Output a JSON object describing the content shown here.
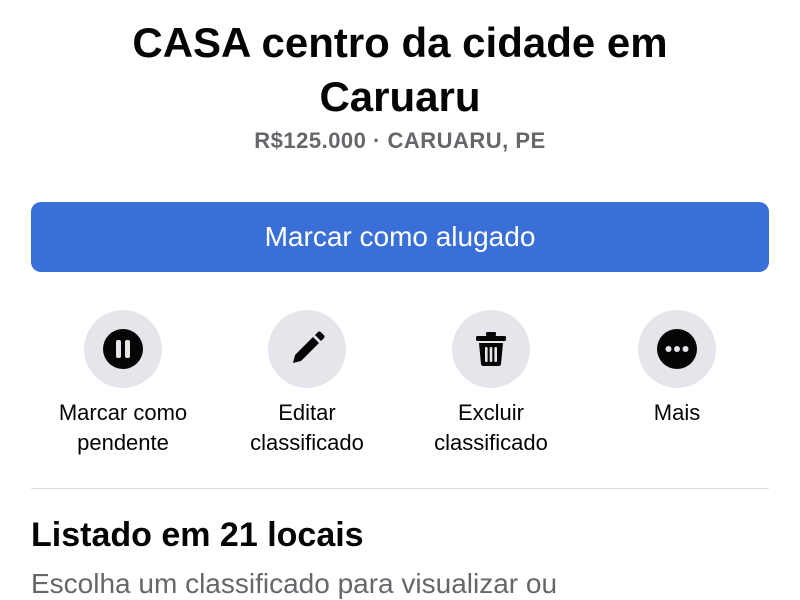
{
  "listing": {
    "title": "CASA centro da cidade em Caruaru",
    "subtitle": "R$125.000 · CARUARU, PE"
  },
  "primary_action": {
    "label": "Marcar como alugado",
    "color": "#3a6fd8"
  },
  "actions": [
    {
      "icon": "pause-icon",
      "label": "Marcar como\npendente"
    },
    {
      "icon": "pencil-icon",
      "label": "Editar\nclassificado"
    },
    {
      "icon": "trash-icon",
      "label": "Excluir\nclassificado"
    },
    {
      "icon": "more-dots-icon",
      "label": "Mais"
    }
  ],
  "locations_section": {
    "title": "Listado em 21 locais",
    "description": "Escolha um classificado para visualizar ou"
  }
}
